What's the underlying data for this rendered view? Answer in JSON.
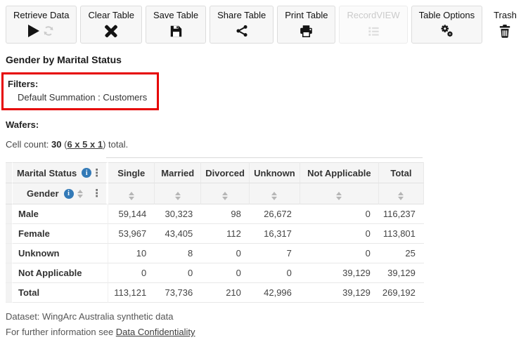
{
  "colors": {
    "highlight_red": "#e60000",
    "info_blue": "#337ab7"
  },
  "icons": [
    "play-icon",
    "refresh-icon",
    "clear-x-icon",
    "save-floppy-icon",
    "share-icon",
    "printer-icon",
    "record-list-icon",
    "gears-icon",
    "trash-icon",
    "info-icon",
    "kebab-menu-icon",
    "sort-icon"
  ],
  "toolbar": {
    "buttons": [
      {
        "label": "Retrieve Data",
        "enabled": true
      },
      {
        "label": "Clear Table",
        "enabled": true
      },
      {
        "label": "Save Table",
        "enabled": true
      },
      {
        "label": "Share Table",
        "enabled": true
      },
      {
        "label": "Print Table",
        "enabled": true
      },
      {
        "label": "RecordVIEW",
        "enabled": false
      },
      {
        "label": "Table Options",
        "enabled": true
      },
      {
        "label": "Trash",
        "enabled": true
      }
    ]
  },
  "page": {
    "title": "Gender by Marital Status",
    "filters": {
      "label": "Filters:",
      "value": "Default Summation : Customers"
    },
    "wafers_label": "Wafers:",
    "cell_count": {
      "prefix": "Cell count: ",
      "value": "30",
      "pre_link": " (",
      "link": "6 x 5 x 1",
      "post_link": ") ",
      "suffix": "total."
    }
  },
  "table": {
    "column_dimension": "Marital Status",
    "row_dimension": "Gender",
    "columns": [
      "Single",
      "Married",
      "Divorced",
      "Unknown",
      "Not Applicable",
      "Total"
    ],
    "rows": [
      {
        "label": "Male",
        "values": [
          "59,144",
          "30,323",
          "98",
          "26,672",
          "0",
          "116,237"
        ]
      },
      {
        "label": "Female",
        "values": [
          "53,967",
          "43,405",
          "112",
          "16,317",
          "0",
          "113,801"
        ]
      },
      {
        "label": "Unknown",
        "values": [
          "10",
          "8",
          "0",
          "7",
          "0",
          "25"
        ]
      },
      {
        "label": "Not Applicable",
        "values": [
          "0",
          "0",
          "0",
          "0",
          "39,129",
          "39,129"
        ]
      },
      {
        "label": "Total",
        "values": [
          "113,121",
          "73,736",
          "210",
          "42,996",
          "39,129",
          "269,192"
        ]
      }
    ]
  },
  "footer": {
    "dataset_line": "Dataset: WingArc Australia synthetic data",
    "info_prefix": "For further information see ",
    "info_link": "Data Confidentiality"
  }
}
